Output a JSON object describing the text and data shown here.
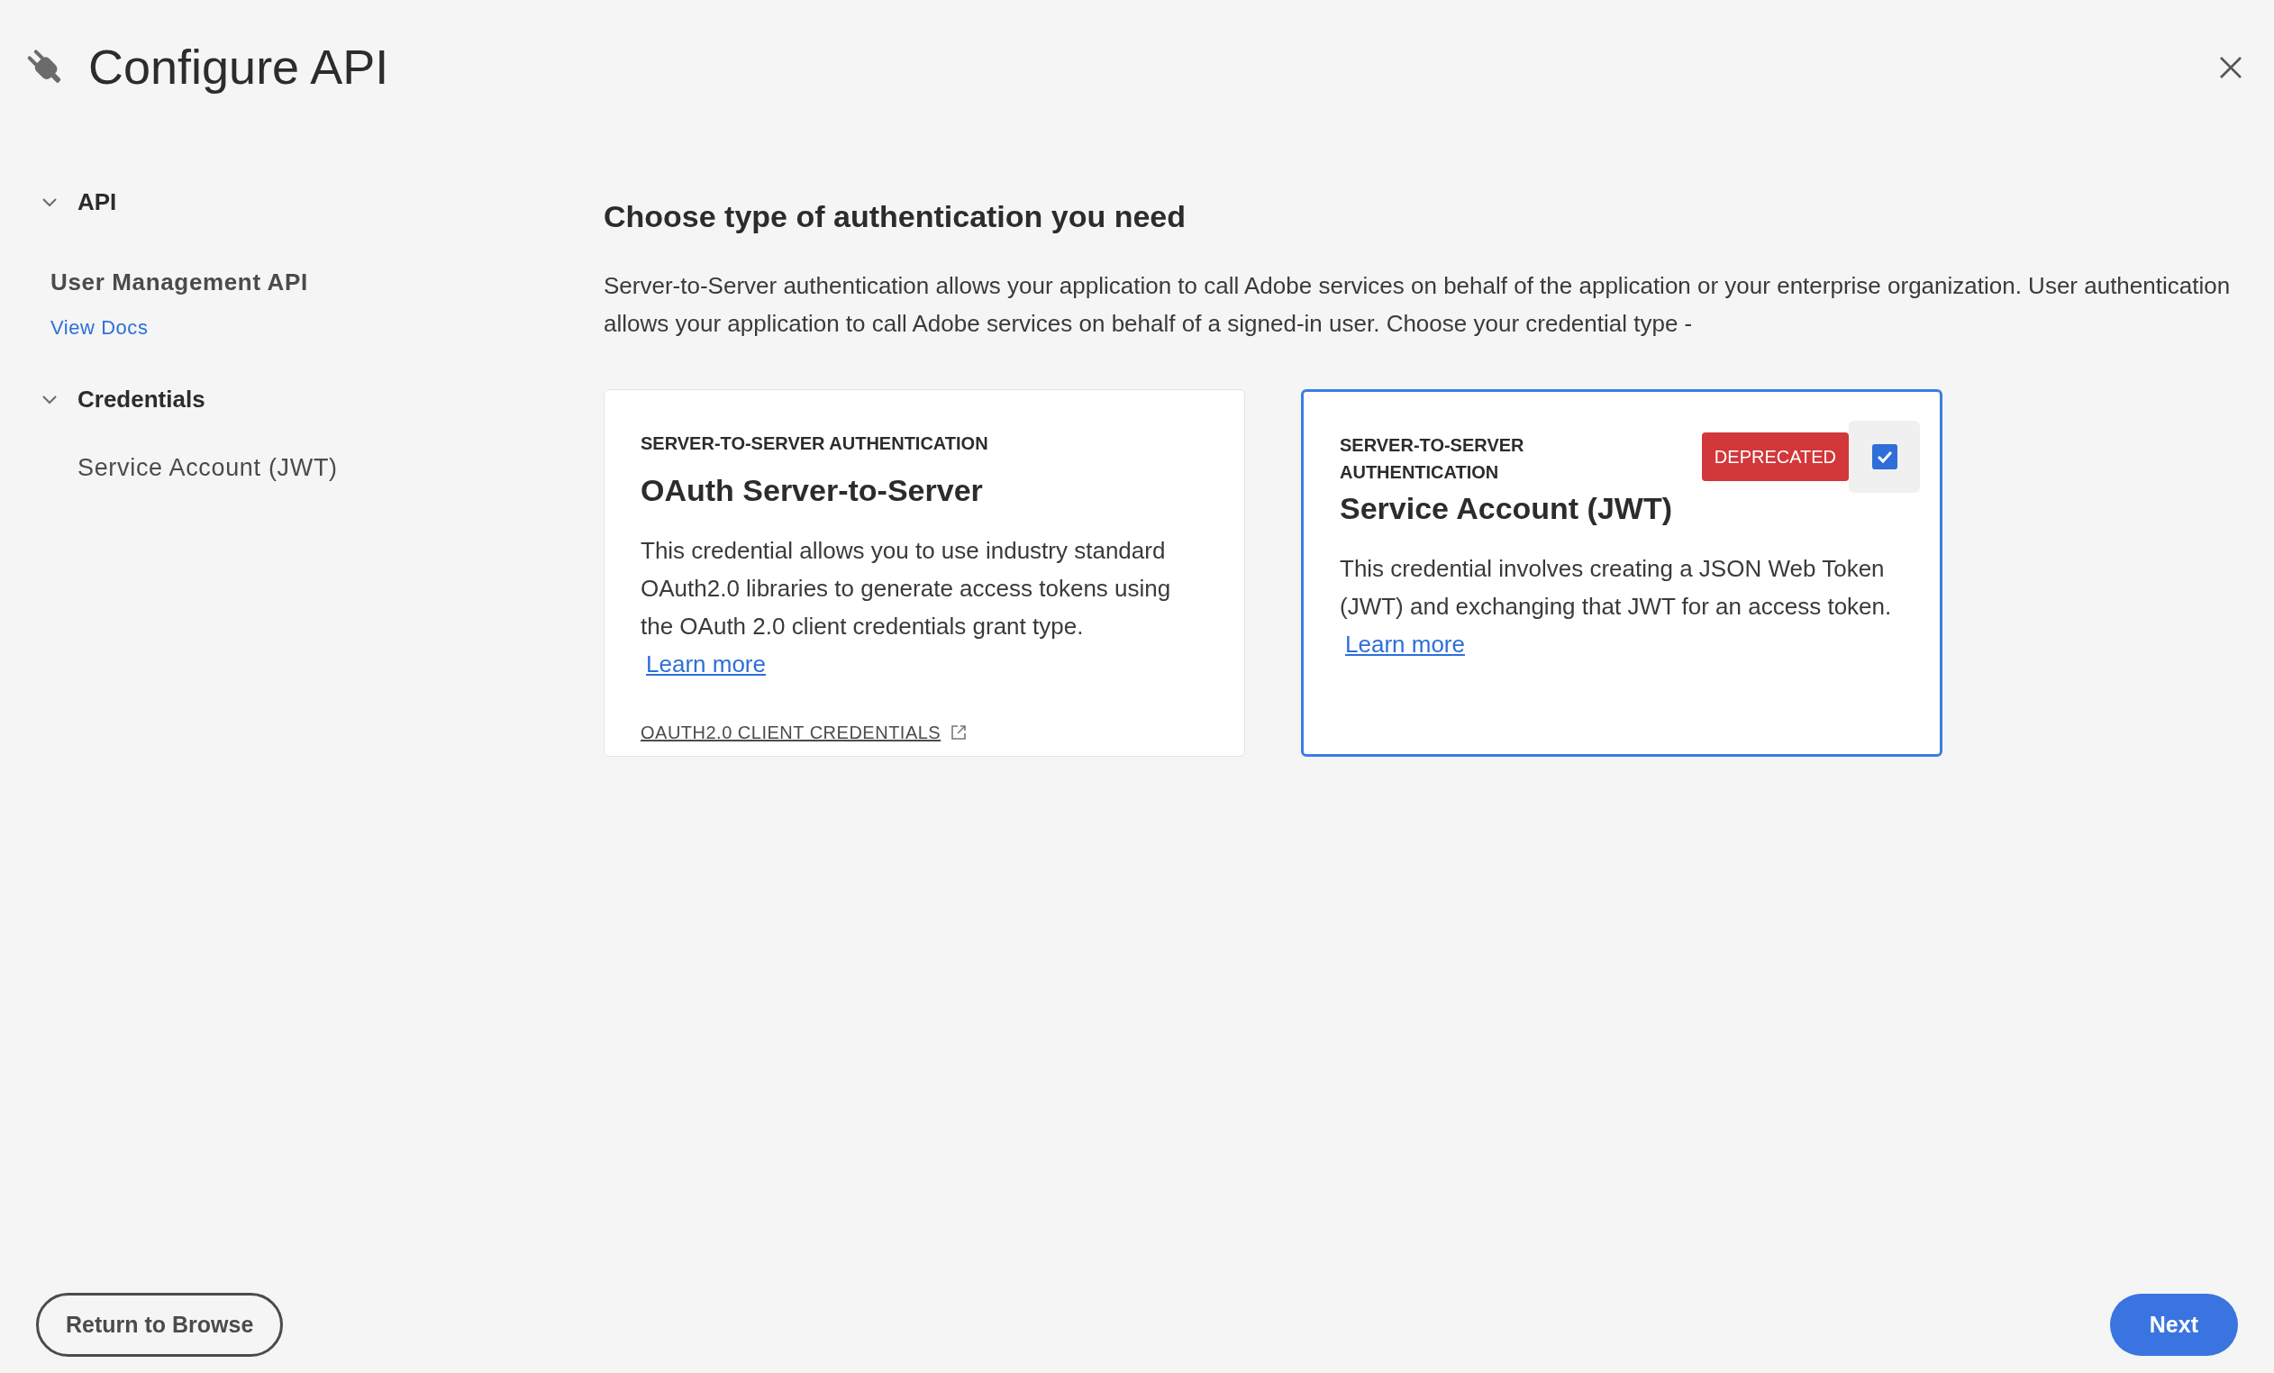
{
  "window": {
    "title": "Configure API"
  },
  "sidebar": {
    "sections": [
      {
        "label": "API",
        "expanded": true,
        "api_name": "User Management API",
        "link": "View Docs"
      },
      {
        "label": "Credentials",
        "expanded": true,
        "items": [
          "Service Account (JWT)"
        ]
      }
    ]
  },
  "main": {
    "heading": "Choose type of authentication you need",
    "description": "Server-to-Server authentication allows your application to call Adobe services on behalf of the application or your enterprise organization. User authentication allows your application to call Adobe services on behalf of a signed-in user. Choose your credential type -",
    "cards": [
      {
        "eyebrow": "SERVER-TO-SERVER AUTHENTICATION",
        "title": "OAuth Server-to-Server",
        "body": "This credential allows you to use industry standard OAuth2.0 libraries to generate access tokens using the OAuth 2.0 client credentials grant type.",
        "link": "Learn more",
        "footer_link": "OAUTH2.0 CLIENT CREDENTIALS",
        "selected": false
      },
      {
        "eyebrow": "SERVER-TO-SERVER AUTHENTICATION",
        "title": "Service Account (JWT)",
        "badge": "DEPRECATED",
        "body": "This credential involves creating a JSON Web Token (JWT) and exchanging that JWT for an access token.",
        "link": "Learn more",
        "selected": true
      }
    ]
  },
  "footer": {
    "back_button": "Return to Browse",
    "next_button": "Next"
  }
}
